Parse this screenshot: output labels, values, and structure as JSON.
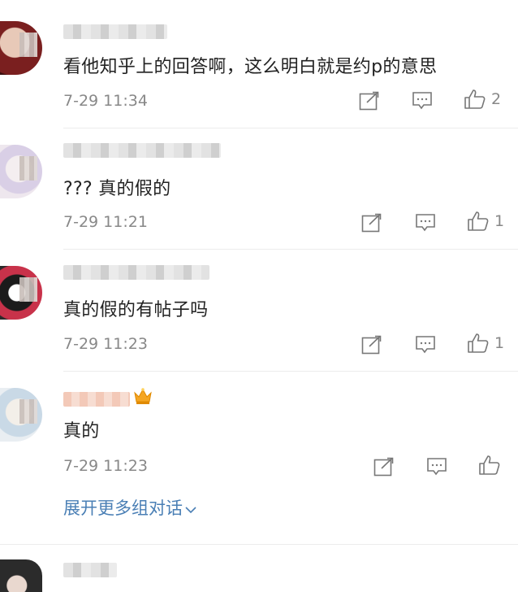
{
  "comments": [
    {
      "text": "看他知乎上的回答啊，这么明白就是约p的意思",
      "time": "7-29 11:34",
      "likes": "2"
    },
    {
      "text": "??? 真的假的",
      "time": "7-29 11:21",
      "likes": "1"
    },
    {
      "text": "真的假的有帖子吗",
      "time": "7-29 11:23",
      "likes": "1"
    },
    {
      "text": "真的",
      "time": "7-29 11:23",
      "likes": ""
    }
  ],
  "expand_label": "展开更多组对话",
  "colors": {
    "link": "#4a7fb5",
    "meta": "#888888",
    "icon": "#777777"
  },
  "icons": [
    "share-icon",
    "comment-icon",
    "thumbs-up-icon",
    "chevron-down-icon",
    "crown-icon"
  ]
}
